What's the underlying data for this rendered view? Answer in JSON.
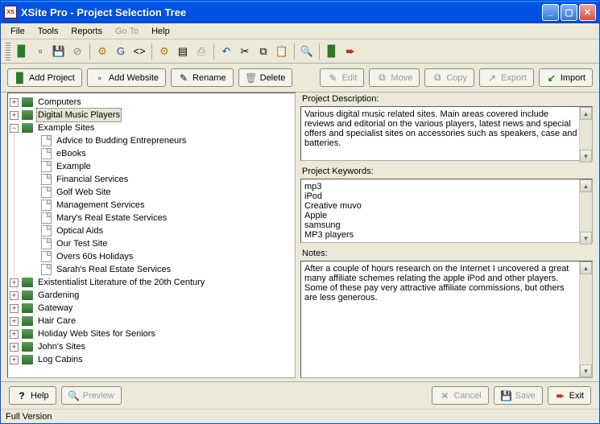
{
  "window": {
    "title": "XSite Pro - Project Selection Tree"
  },
  "menu": {
    "file": "File",
    "tools": "Tools",
    "reports": "Reports",
    "goto": "Go To",
    "help": "Help"
  },
  "actions": {
    "add_project": "Add Project",
    "add_website": "Add Website",
    "rename": "Rename",
    "delete": "Delete",
    "edit": "Edit",
    "move": "Move",
    "copy": "Copy",
    "export": "Export",
    "import": "Import"
  },
  "tree": {
    "items": [
      {
        "label": "Computers",
        "type": "project",
        "expand": "plus"
      },
      {
        "label": "Digital Music Players",
        "type": "project",
        "expand": "plus",
        "selected": true
      },
      {
        "label": "Example Sites",
        "type": "project",
        "expand": "minus",
        "children": [
          {
            "label": "Advice to Budding Entrepreneurs"
          },
          {
            "label": "eBooks"
          },
          {
            "label": "Example"
          },
          {
            "label": "Financial Services"
          },
          {
            "label": "Golf Web Site"
          },
          {
            "label": "Management Services"
          },
          {
            "label": "Mary's Real Estate Services"
          },
          {
            "label": "Optical Aids"
          },
          {
            "label": "Our Test Site"
          },
          {
            "label": "Overs 60s Holidays"
          },
          {
            "label": "Sarah's Real Estate Services"
          }
        ]
      },
      {
        "label": "Existentialist Literature of the 20th Century",
        "type": "project",
        "expand": "plus"
      },
      {
        "label": "Gardening",
        "type": "project",
        "expand": "plus"
      },
      {
        "label": "Gateway",
        "type": "project",
        "expand": "plus"
      },
      {
        "label": "Hair Care",
        "type": "project",
        "expand": "plus"
      },
      {
        "label": "Holiday Web Sites for Seniors",
        "type": "project",
        "expand": "plus"
      },
      {
        "label": "John's Sites",
        "type": "project",
        "expand": "plus"
      },
      {
        "label": "Log Cabins",
        "type": "project",
        "expand": "plus"
      }
    ]
  },
  "panels": {
    "desc_label": "Project Description:",
    "desc_value": "Various digital music related sites. Main areas covered include reviews and editorial on the various players, latest news and special offers and specialist sites on accessories such as speakers, case and batteries.",
    "keywords_label": "Project Keywords:",
    "keywords_value": "mp3\niPod\nCreative muvo\nApple\nsamsung\nMP3 players",
    "notes_label": "Notes:",
    "notes_value": "After a couple of hours research on the Internet I uncovered a great many affiliate schemes relating the apple iPod and other players. Some of these pay very attractive affiliate commissions, but others are less generous."
  },
  "bottom": {
    "help": "Help",
    "preview": "Preview",
    "cancel": "Cancel",
    "save": "Save",
    "exit": "Exit"
  },
  "status": {
    "text": "Full Version"
  }
}
